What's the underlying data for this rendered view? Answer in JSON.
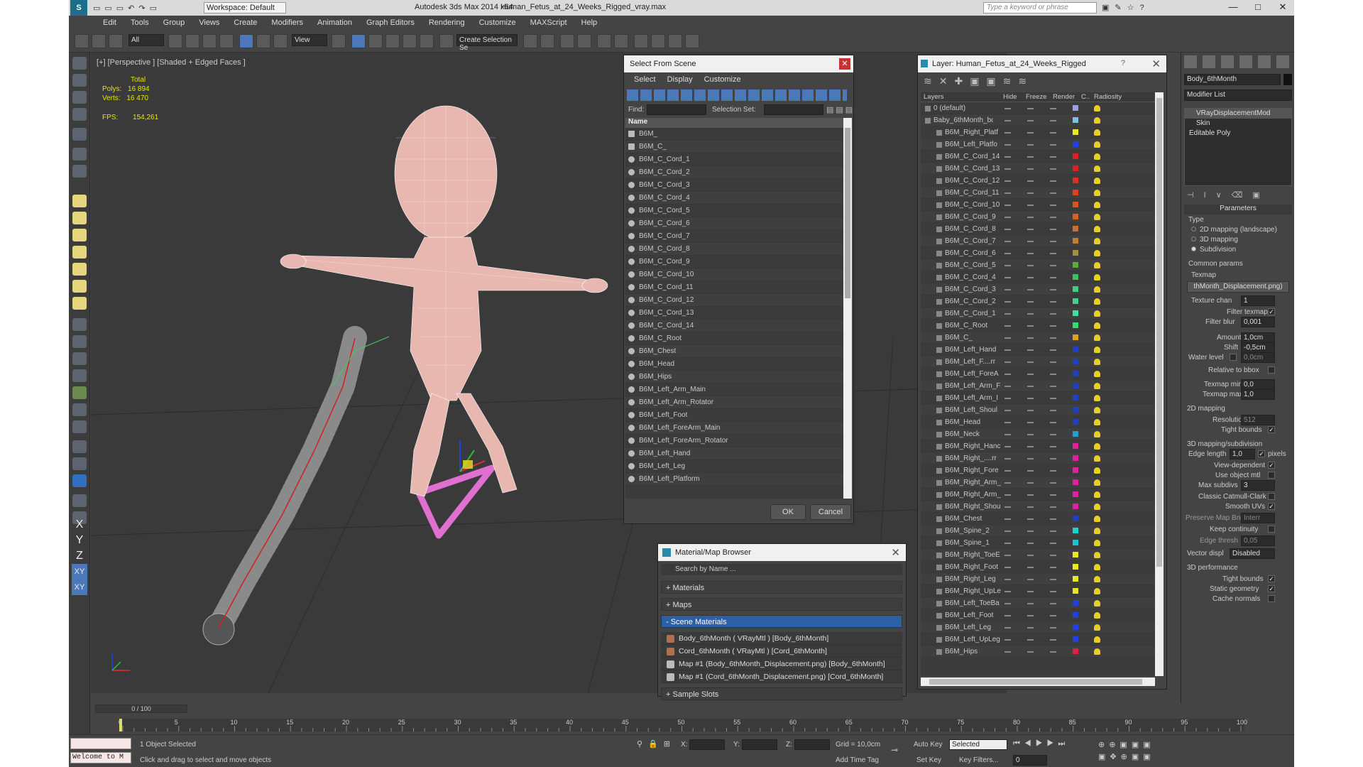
{
  "title": {
    "app": "Autodesk 3ds Max  2014 x64",
    "file": "Human_Fetus_at_24_Weeks_Rigged_vray.max",
    "workspace": "Workspace: Default",
    "search_placeholder": "Type a keyword or phrase"
  },
  "menu": [
    "Edit",
    "Tools",
    "Group",
    "Views",
    "Create",
    "Modifiers",
    "Animation",
    "Graph Editors",
    "Rendering",
    "Customize",
    "MAXScript",
    "Help"
  ],
  "toolbar": {
    "filter": "All",
    "refcoord": "View",
    "snap": "2.5",
    "selset": "Create Selection Se"
  },
  "viewport": {
    "label": "[+] [Perspective ] [Shaded + Edged Faces ]",
    "stats_total": "Total",
    "polys_label": "Polys:",
    "polys": "16 894",
    "verts_label": "Verts:",
    "verts": "16 470",
    "fps_label": "FPS:",
    "fps": "154,261"
  },
  "axis_buttons": [
    "X",
    "Y",
    "Z",
    "XY",
    "XY"
  ],
  "select_dialog": {
    "title": "Select From Scene",
    "menu": [
      "Select",
      "Display",
      "Customize"
    ],
    "find_label": "Find:",
    "selset_label": "Selection Set:",
    "col_name": "Name",
    "ok": "OK",
    "cancel": "Cancel",
    "items": [
      "B6M_",
      "B6M_C_",
      "B6M_C_Cord_1",
      "B6M_C_Cord_2",
      "B6M_C_Cord_3",
      "B6M_C_Cord_4",
      "B6M_C_Cord_5",
      "B6M_C_Cord_6",
      "B6M_C_Cord_7",
      "B6M_C_Cord_8",
      "B6M_C_Cord_9",
      "B6M_C_Cord_10",
      "B6M_C_Cord_11",
      "B6M_C_Cord_12",
      "B6M_C_Cord_13",
      "B6M_C_Cord_14",
      "B6M_C_Root",
      "B6M_Chest",
      "B6M_Head",
      "B6M_Hips",
      "B6M_Left_Arm_Main",
      "B6M_Left_Arm_Rotator",
      "B6M_Left_Foot",
      "B6M_Left_ForeArm_Main",
      "B6M_Left_ForeArm_Rotator",
      "B6M_Left_Hand",
      "B6M_Left_Leg",
      "B6M_Left_Platform"
    ]
  },
  "layer_dialog": {
    "title": "Layer: Human_Fetus_at_24_Weeks_Rigged",
    "help": "?",
    "cols": [
      "Layers",
      "Hide",
      "Freeze",
      "Render",
      "C..",
      "Radiosity"
    ],
    "root": "0 (default)",
    "group": "Baby_6thMonth_bo",
    "items": [
      {
        "n": "B6M_Right_Platf",
        "c": "#e8e820"
      },
      {
        "n": "B6M_Left_Platfo",
        "c": "#2040e0"
      },
      {
        "n": "B6M_C_Cord_14",
        "c": "#e02020"
      },
      {
        "n": "B6M_C_Cord_13",
        "c": "#e02020"
      },
      {
        "n": "B6M_C_Cord_12",
        "c": "#e03020"
      },
      {
        "n": "B6M_C_Cord_11",
        "c": "#e04020"
      },
      {
        "n": "B6M_C_Cord_10",
        "c": "#e05020"
      },
      {
        "n": "B6M_C_Cord_9",
        "c": "#d86020"
      },
      {
        "n": "B6M_C_Cord_8",
        "c": "#c87030"
      },
      {
        "n": "B6M_C_Cord_7",
        "c": "#c08030"
      },
      {
        "n": "B6M_C_Cord_6",
        "c": "#a09040"
      },
      {
        "n": "B6M_C_Cord_5",
        "c": "#60a840"
      },
      {
        "n": "B6M_C_Cord_4",
        "c": "#40c060"
      },
      {
        "n": "B6M_C_Cord_3",
        "c": "#40d080"
      },
      {
        "n": "B6M_C_Cord_2",
        "c": "#40d090"
      },
      {
        "n": "B6M_C_Cord_1",
        "c": "#40e0a0"
      },
      {
        "n": "B6M_C_Root",
        "c": "#30e070"
      },
      {
        "n": "B6M_C_",
        "c": "#e0a020"
      },
      {
        "n": "B6M_Left_Hand",
        "c": "#2040c0"
      },
      {
        "n": "B6M_Left_F....rr",
        "c": "#2040c0"
      },
      {
        "n": "B6M_Left_ForeA",
        "c": "#2040c0"
      },
      {
        "n": "B6M_Left_Arm_F",
        "c": "#2040c0"
      },
      {
        "n": "B6M_Left_Arm_I",
        "c": "#2040c0"
      },
      {
        "n": "B6M_Left_Shoul",
        "c": "#2040c0"
      },
      {
        "n": "B6M_Head",
        "c": "#2040c0"
      },
      {
        "n": "B6M_Neck",
        "c": "#20a0d0"
      },
      {
        "n": "B6M_Right_Hanc",
        "c": "#e020a0"
      },
      {
        "n": "B6M_Right_....rr",
        "c": "#e020a0"
      },
      {
        "n": "B6M_Right_Fore",
        "c": "#e020a0"
      },
      {
        "n": "B6M_Right_Arm_",
        "c": "#e020a0"
      },
      {
        "n": "B6M_Right_Arm_",
        "c": "#e020a0"
      },
      {
        "n": "B6M_Right_Shou",
        "c": "#e020a0"
      },
      {
        "n": "B6M_Chest",
        "c": "#2040c0"
      },
      {
        "n": "B6M_Spine_2",
        "c": "#20d0d0"
      },
      {
        "n": "B6M_Spine_1",
        "c": "#20c0d0"
      },
      {
        "n": "B6M_Right_ToeE",
        "c": "#e8e820"
      },
      {
        "n": "B6M_Right_Foot",
        "c": "#e8e820"
      },
      {
        "n": "B6M_Right_Leg",
        "c": "#e8e820"
      },
      {
        "n": "B6M_Right_UpLe",
        "c": "#e8e820"
      },
      {
        "n": "B6M_Left_ToeBa",
        "c": "#2040e0"
      },
      {
        "n": "B6M_Left_Foot",
        "c": "#2040e0"
      },
      {
        "n": "B6M_Left_Leg",
        "c": "#2040e0"
      },
      {
        "n": "B6M_Left_UpLeg",
        "c": "#2040e0"
      },
      {
        "n": "B6M_Hips",
        "c": "#e02040"
      }
    ]
  },
  "material_browser": {
    "title": "Material/Map Browser",
    "search_placeholder": "Search by Name ...",
    "sections": [
      "+ Materials",
      "+ Maps",
      "- Scene Materials",
      "+ Sample Slots"
    ],
    "materials": [
      {
        "label": "Body_6thMonth  ( VRayMtl ) [Body_6thMonth]",
        "type": "mtl"
      },
      {
        "label": "Cord_6thMonth  ( VRayMtl ) [Cord_6thMonth]",
        "type": "mtl"
      },
      {
        "label": "Map #1 (Body_6thMonth_Displacement.png) [Body_6thMonth]",
        "type": "map"
      },
      {
        "label": "Map #1 (Cord_6thMonth_Displacement.png) [Cord_6thMonth]",
        "type": "map"
      }
    ]
  },
  "command_panel": {
    "object_name": "Body_6thMonth",
    "modifier_list": "Modifier List",
    "stack": [
      "VRayDisplacementMod",
      "Skin",
      "Editable Poly"
    ],
    "params_title": "Parameters",
    "type_label": "Type",
    "types": [
      "2D mapping (landscape)",
      "3D mapping",
      "Subdivision"
    ],
    "common_params": "Common params",
    "texmap": "Texmap",
    "texmap_value": "thMonth_Displacement.png)",
    "texture_chan": "Texture chan",
    "texture_chan_v": "1",
    "filter_texmap": "Filter texmap",
    "filter_blur": "Filter blur",
    "filter_blur_v": "0,001",
    "amount": "Amount",
    "amount_v": "1,0cm",
    "shift": "Shift",
    "shift_v": "-0,5cm",
    "water_level": "Water level",
    "water_level_v": "0,0cm",
    "relative_bbox": "Relative to bbox",
    "texmap_min": "Texmap min",
    "texmap_min_v": "0,0",
    "texmap_max": "Texmap max",
    "texmap_max_v": "1,0",
    "mapping2d": "2D mapping",
    "resolution": "Resolution",
    "resolution_v": "512",
    "tight_bounds": "Tight bounds",
    "mapping3d": "3D mapping/subdivision",
    "edge_length": "Edge length",
    "edge_length_v": "1,0",
    "pixels": "pixels",
    "view_dependent": "View-dependent",
    "use_object_mtl": "Use object mtl",
    "max_subdivs": "Max subdivs",
    "max_subdivs_v": "3",
    "catmull": "Classic Catmull-Clark",
    "smooth_uvs": "Smooth UVs",
    "preserve_map": "Preserve Map Bnd",
    "preserve_map_v": "Interr",
    "keep_continuity": "Keep continuity",
    "edge_thresh": "Edge thresh",
    "edge_thresh_v": "0,05",
    "vector_displ": "Vector displ",
    "vector_displ_v": "Disabled",
    "perf3d": "3D performance",
    "tight_bounds2": "Tight bounds",
    "static_geometry": "Static geometry",
    "cache_normals": "Cache normals"
  },
  "timeline": {
    "frame": "0 / 100",
    "ticks": [
      "0",
      "5",
      "10",
      "15",
      "20",
      "25",
      "30",
      "35",
      "40",
      "45",
      "50",
      "55",
      "60",
      "65",
      "70",
      "75",
      "80",
      "85",
      "90",
      "95",
      "100"
    ]
  },
  "status": {
    "maxscript": "Welcome to M",
    "selected": "1 Object Selected",
    "prompt": "Click and drag to select and move objects",
    "x_label": "X:",
    "y_label": "Y:",
    "z_label": "Z:",
    "grid": "Grid = 10,0cm",
    "auto_key": "Auto Key",
    "set_key": "Set Key",
    "key_mode": "Selected",
    "key_filters": "Key Filters...",
    "add_time_tag": "Add Time Tag",
    "frame_field": "0"
  }
}
